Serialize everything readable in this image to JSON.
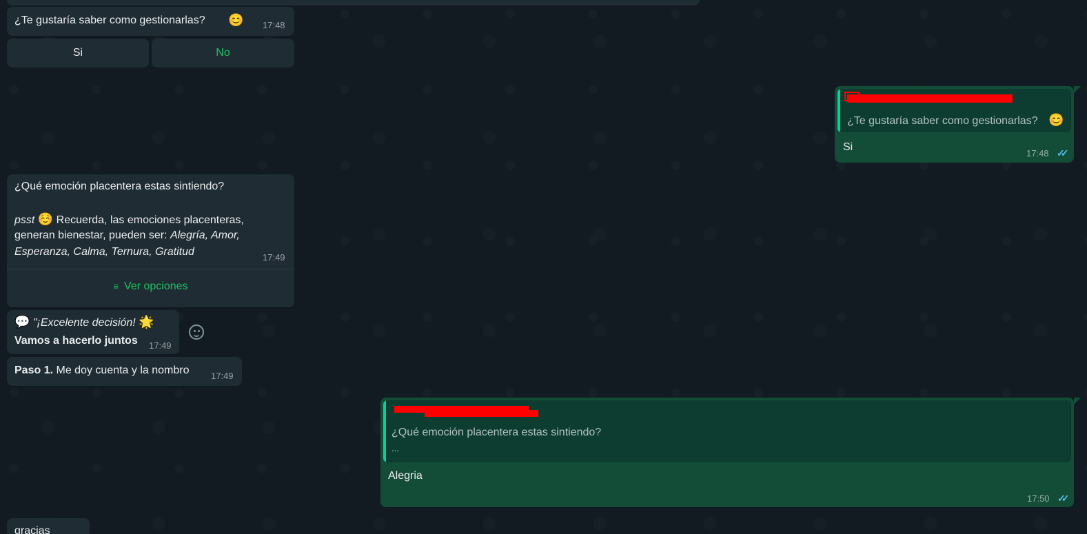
{
  "messages": {
    "q1": {
      "text": "¿Te gustaría saber como gestionarlas?",
      "emoji": "😊",
      "time": "17:48"
    },
    "q1_buttons": {
      "yes": "Si",
      "no": "No"
    },
    "reply1": {
      "quote_text": "¿Te gustaría saber como gestionarlas?",
      "quote_emoji": "😊",
      "text": "Si",
      "time": "17:48",
      "ticks": "✓✓"
    },
    "q2": {
      "line1": "¿Qué emoción placentera estas sintiendo?",
      "psst": "psst",
      "psst_emoji": "☺️",
      "line2": "Recuerda, las emociones placenteras,",
      "line3_prefix": "generan bienestar, pueden ser:",
      "line3_italic": "Alegría, Amor,",
      "line4_italic": "Esperanza, Calma, Ternura, Gratitud",
      "time": "17:49",
      "options_label": "Ver opciones",
      "options_icon": "≡"
    },
    "m3": {
      "bubble_emoji": "💬",
      "italic": "\"¡Excelente decisión!",
      "star_emoji": "🌟",
      "bold": "Vamos a hacerlo juntos",
      "time": "17:49"
    },
    "m4": {
      "bold": "Paso 1.",
      "text": "Me doy cuenta y la nombro",
      "time": "17:49"
    },
    "reply2": {
      "quote_line1": "¿Qué emoción placentera estas sintiendo?",
      "quote_line2": "...",
      "text": "Alegria",
      "time": "17:50",
      "ticks": "✓✓"
    },
    "m5": {
      "text": "gracias"
    }
  },
  "colors": {
    "incoming": "#202c33",
    "outgoing": "#144d37",
    "accent": "#21c063",
    "ticks": "#53bdeb"
  }
}
